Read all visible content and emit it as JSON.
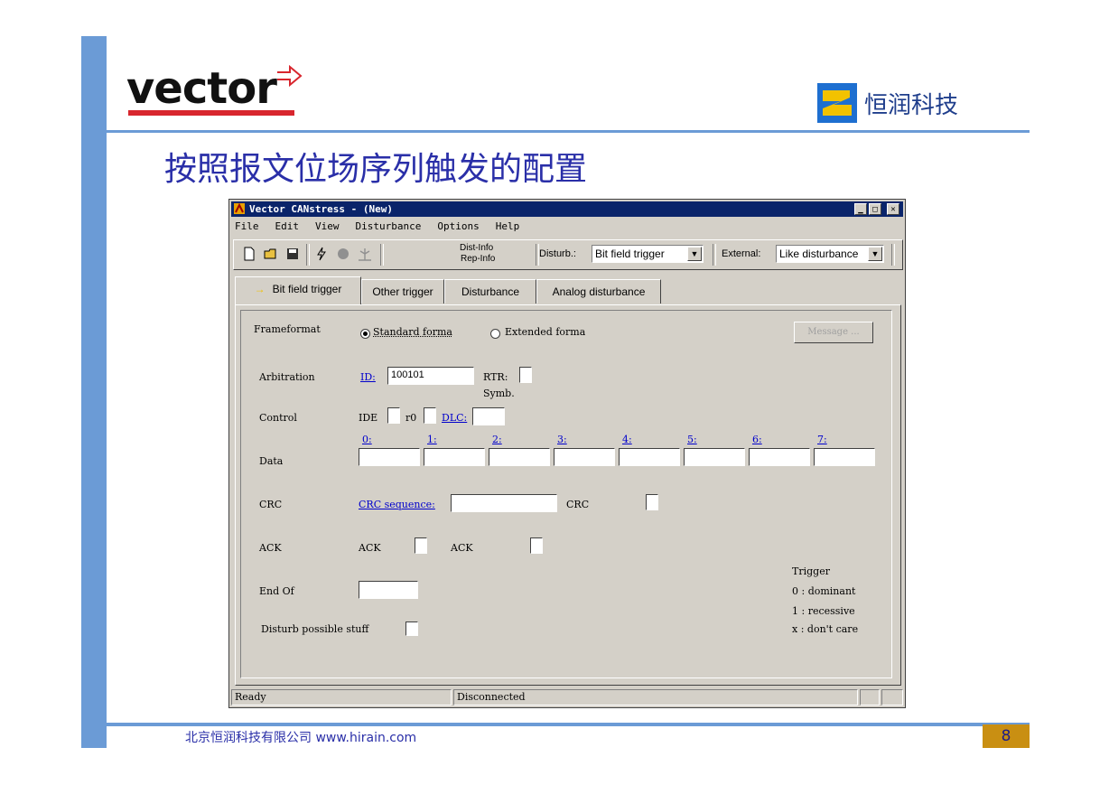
{
  "slide": {
    "vector_logo": "vector",
    "hirain_logo": "恒润科技",
    "title": "按照报文位场序列触发的配置",
    "footer_company": "北京恒润科技有限公司",
    "footer_url": "www.hirain.com",
    "page_number": "8",
    "colors": {
      "accent_bar": "#6b9bd6",
      "title": "#2a2fa8",
      "badge": "#c98f12",
      "vector_red": "#d8262e"
    }
  },
  "window": {
    "title": "Vector CANstress - (New)",
    "menu": [
      "File",
      "Edit",
      "View",
      "Disturbance",
      "Options",
      "Help"
    ],
    "toolbar": {
      "icons": [
        "new-file-icon",
        "open-folder-icon",
        "save-disk-icon",
        "lightning-icon",
        "record-dot-icon",
        "antenna-icon"
      ],
      "dist_info": "Dist-Info",
      "rep_info": "Rep-Info",
      "disturb_label": "Disturb.:",
      "disturb_value": "Bit field trigger",
      "external_label": "External:",
      "external_value": "Like disturbance"
    },
    "tabs": [
      "Bit field trigger",
      "Other trigger",
      "Disturbance",
      "Analog disturbance"
    ],
    "form": {
      "frameformat_label": "Frameformat",
      "standard_format": "Standard forma",
      "extended_format": "Extended forma",
      "message_button": "Message ...",
      "arbitration_label": "Arbitration",
      "id_label": "ID:",
      "id_value": "100101",
      "rtr_label": "RTR:",
      "symb_label": "Symb.",
      "control_label": "Control",
      "ide_label": "IDE",
      "r0_label": "r0",
      "dlc_label": "DLC:",
      "data_label": "Data",
      "data_bytes": [
        "0:",
        "1:",
        "2:",
        "3:",
        "4:",
        "5:",
        "6:",
        "7:"
      ],
      "crc_label": "CRC",
      "crc_sequence_label": "CRC sequence:",
      "crc_label2": "CRC",
      "ack_label": "ACK",
      "ack_label2": "ACK",
      "ack_label3": "ACK",
      "end_of_label": "End Of",
      "disturb_stuff_label": "Disturb possible stuff",
      "legend": [
        "Trigger",
        "0 : dominant",
        "1 : recessive",
        "x : don't care"
      ]
    },
    "status": {
      "left": "Ready",
      "middle": "Disconnected"
    }
  }
}
